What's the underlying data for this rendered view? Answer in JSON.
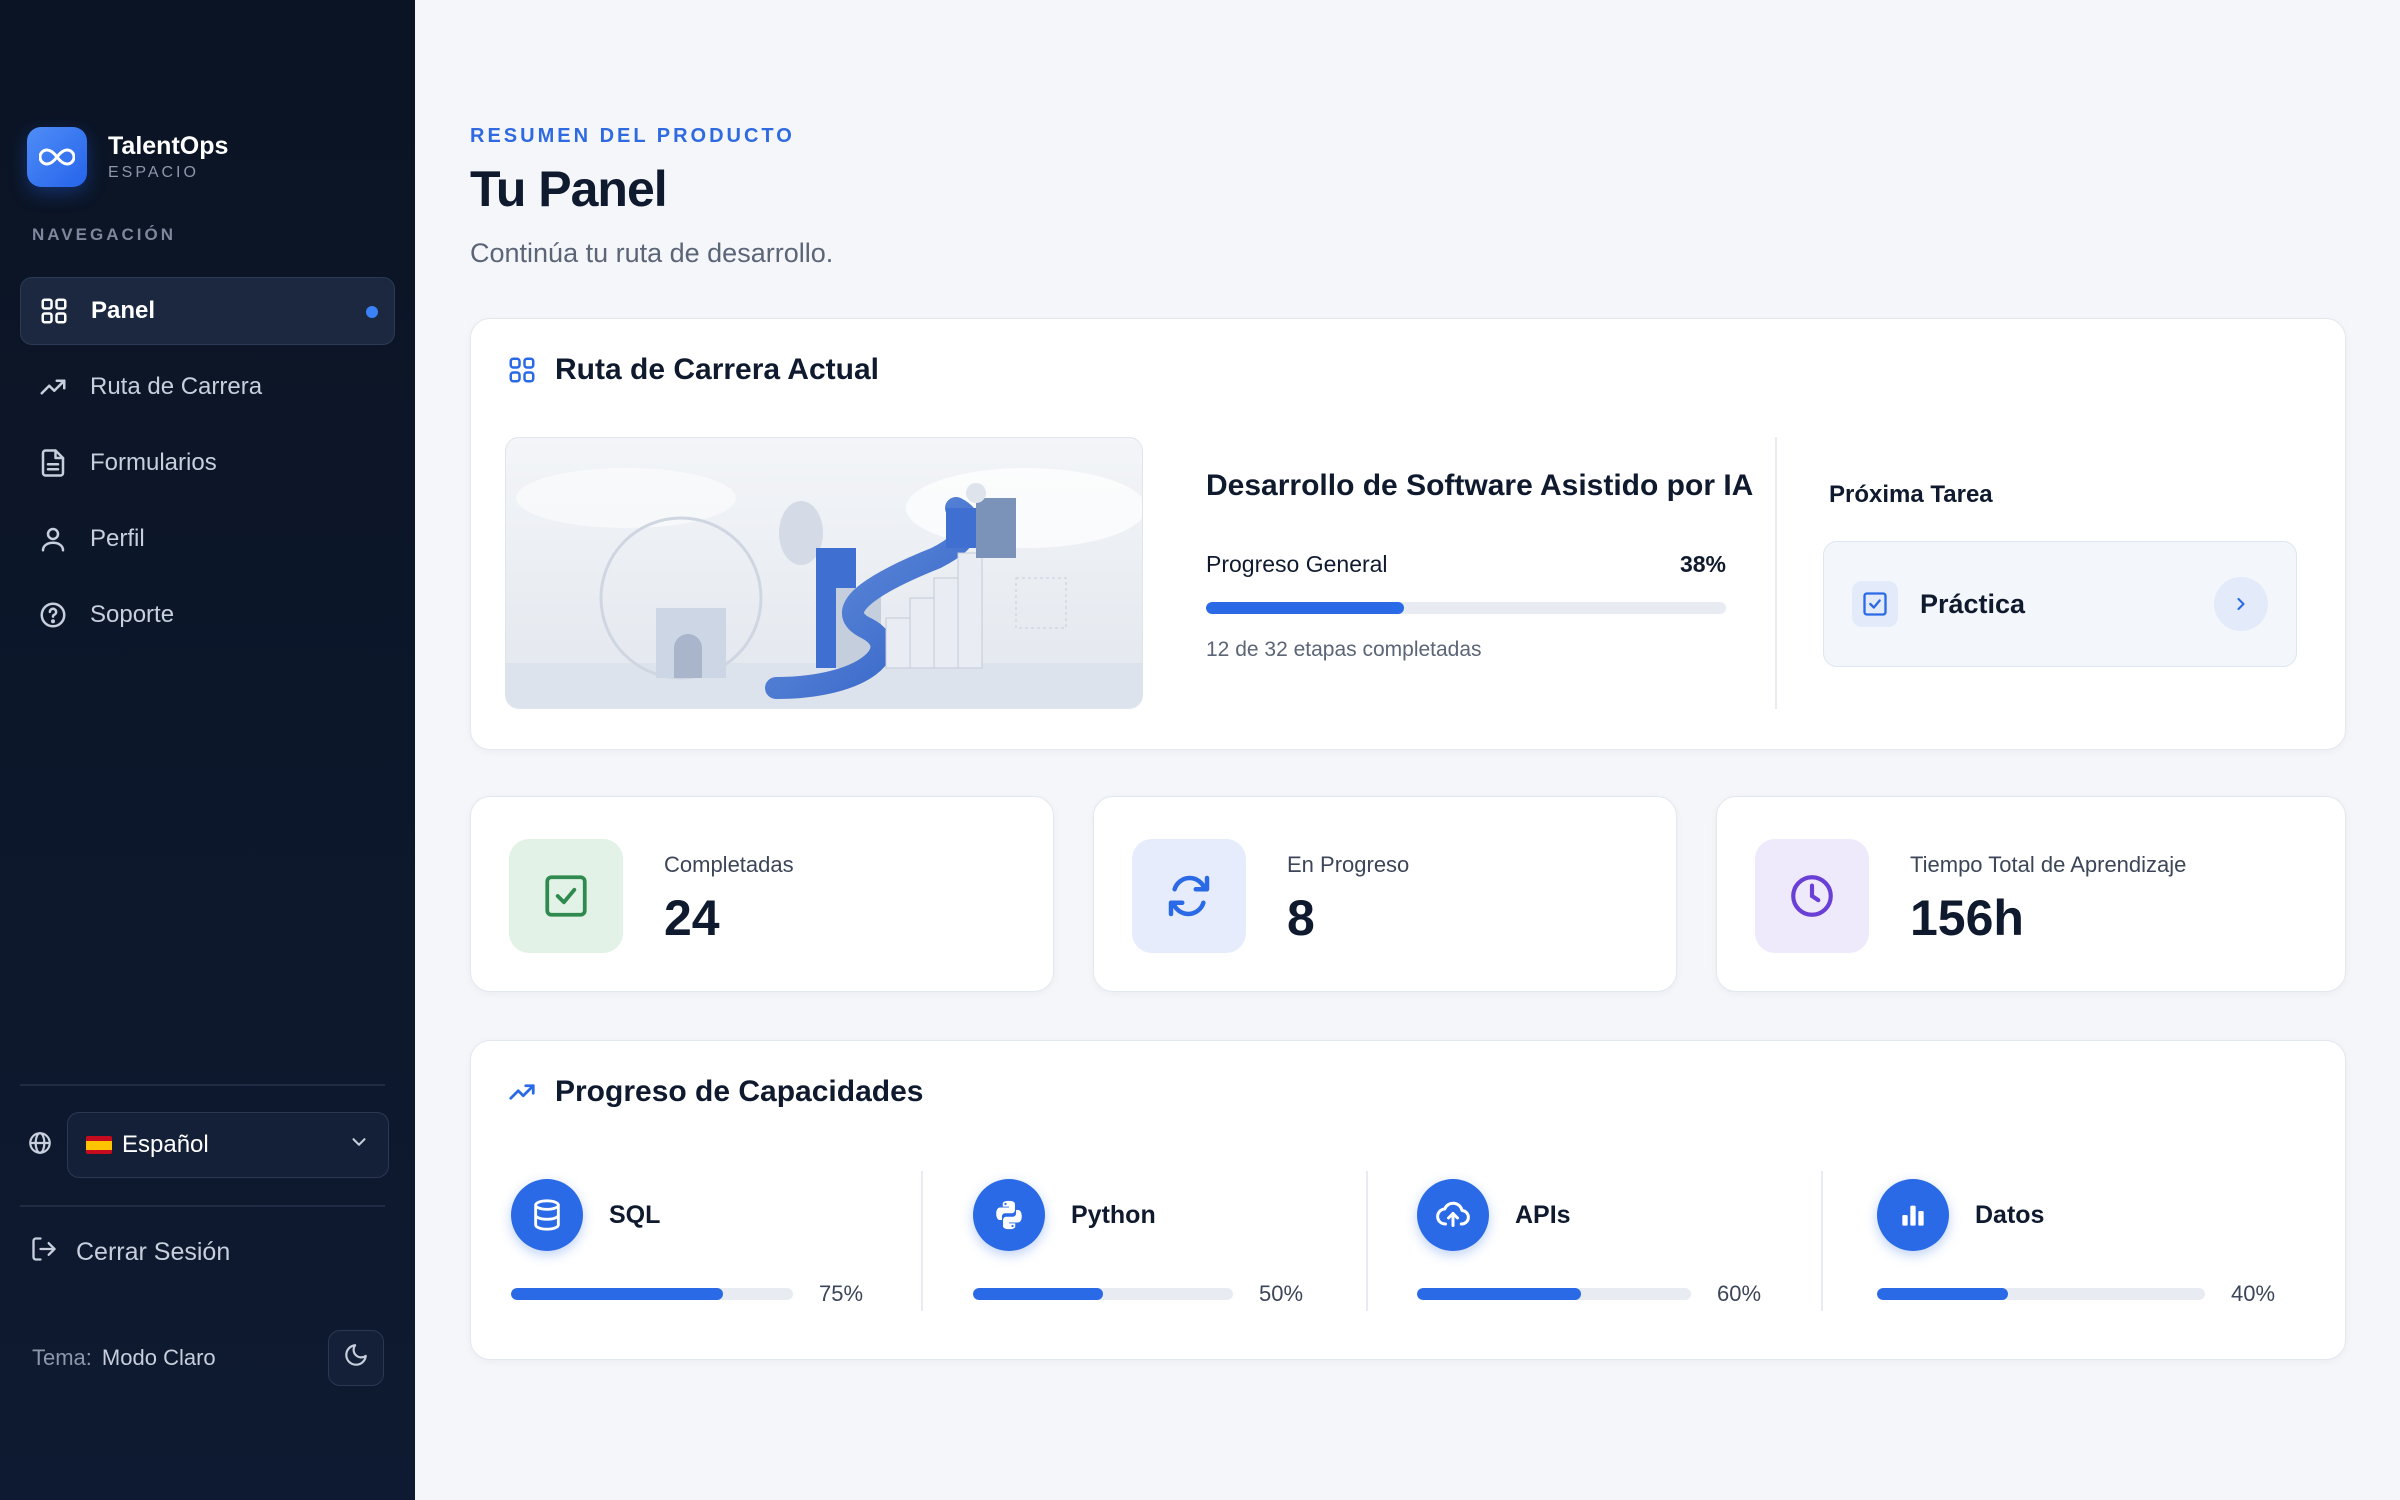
{
  "sidebar": {
    "brand": {
      "name": "TalentOps",
      "subtitle": "ESPACIO"
    },
    "nav_heading": "NAVEGACIÓN",
    "items": [
      {
        "label": "Panel",
        "icon": "grid-icon",
        "active": true
      },
      {
        "label": "Ruta de Carrera",
        "icon": "trending-up-icon"
      },
      {
        "label": "Formularios",
        "icon": "document-icon"
      },
      {
        "label": "Perfil",
        "icon": "user-icon"
      },
      {
        "label": "Soporte",
        "icon": "help-circle-icon"
      }
    ],
    "language": {
      "selected": "Español",
      "flag": "spain-flag-icon"
    },
    "logout_label": "Cerrar Sesión",
    "theme": {
      "label": "Tema:",
      "value": "Modo Claro"
    }
  },
  "header": {
    "eyebrow": "RESUMEN DEL PRODUCTO",
    "title": "Tu Panel",
    "subtitle": "Continúa tu ruta de desarrollo."
  },
  "career": {
    "heading": "Ruta de Carrera Actual",
    "course_title": "Desarrollo de Software Asistido por IA",
    "progress_label": "Progreso General",
    "progress_pct": "38%",
    "progress_value": 38,
    "stages_text": "12 de 32 etapas completadas",
    "next_task_label": "Próxima Tarea",
    "next_task_name": "Práctica"
  },
  "stats": [
    {
      "label": "Completadas",
      "value": "24",
      "icon": "check-square-icon"
    },
    {
      "label": "En Progreso",
      "value": "8",
      "icon": "refresh-icon"
    },
    {
      "label": "Tiempo Total de Aprendizaje",
      "value": "156h",
      "icon": "clock-icon"
    }
  ],
  "skills": {
    "heading": "Progreso de Capacidades",
    "items": [
      {
        "name": "SQL",
        "pct": "75%",
        "value": 75,
        "icon": "database-icon"
      },
      {
        "name": "Python",
        "pct": "50%",
        "value": 50,
        "icon": "python-icon"
      },
      {
        "name": "APIs",
        "pct": "60%",
        "value": 60,
        "icon": "cloud-icon"
      },
      {
        "name": "Datos",
        "pct": "40%",
        "value": 40,
        "icon": "bar-chart-icon"
      }
    ]
  },
  "colors": {
    "sidebar_bg": "#0b1424",
    "accent": "#2a6ae6",
    "page_bg": "#f4f6fa"
  }
}
